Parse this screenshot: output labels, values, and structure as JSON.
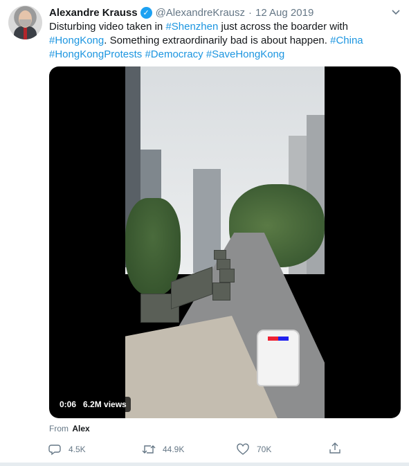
{
  "tweet": {
    "display_name": "Alexandre Krauss",
    "handle": "@AlexandreKrausz",
    "separator": "·",
    "date": "12 Aug 2019",
    "text_parts": [
      {
        "t": "Disturbing video taken in ",
        "tag": false
      },
      {
        "t": "#Shenzhen",
        "tag": true
      },
      {
        "t": " just across the boarder with ",
        "tag": false
      },
      {
        "t": "#HongKong",
        "tag": true
      },
      {
        "t": ". Something extraordinarily bad is about happen. ",
        "tag": false
      },
      {
        "t": "#China",
        "tag": true
      },
      {
        "t": " ",
        "tag": false
      },
      {
        "t": "#HongKongProtests",
        "tag": true
      },
      {
        "t": " ",
        "tag": false
      },
      {
        "t": "#Democracy",
        "tag": true
      },
      {
        "t": " ",
        "tag": false
      },
      {
        "t": "#SaveHongKong",
        "tag": true
      }
    ],
    "video": {
      "duration": "0:06",
      "views": "6.2M views"
    },
    "source": {
      "prefix": "From",
      "name": "Alex"
    },
    "actions": {
      "reply_count": "4.5K",
      "retweet_count": "44.9K",
      "like_count": "70K"
    }
  },
  "icons": {
    "verified": "verified-badge-icon",
    "caret": "chevron-down-icon",
    "reply": "reply-icon",
    "retweet": "retweet-icon",
    "like": "heart-icon",
    "share": "share-icon"
  },
  "colors": {
    "link": "#1b95e0",
    "secondary_text": "#657786",
    "primary_text": "#14171a",
    "verified": "#1da1f2"
  }
}
